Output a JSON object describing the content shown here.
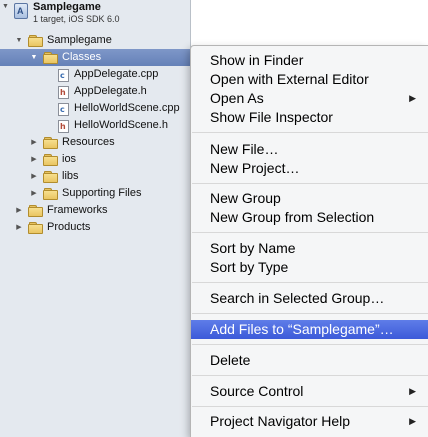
{
  "navigator": {
    "project": {
      "name": "Samplegame",
      "subtitle": "1 target, iOS SDK 6.0"
    },
    "tree": [
      {
        "label": "Samplegame",
        "kind": "folder",
        "disclosure": "expanded"
      },
      {
        "label": "Classes",
        "kind": "folder",
        "disclosure": "expanded",
        "selected": true
      },
      {
        "label": "AppDelegate.cpp",
        "kind": "file",
        "badge": "c"
      },
      {
        "label": "AppDelegate.h",
        "kind": "file",
        "badge": "h"
      },
      {
        "label": "HelloWorldScene.cpp",
        "kind": "file",
        "badge": "c"
      },
      {
        "label": "HelloWorldScene.h",
        "kind": "file",
        "badge": "h"
      },
      {
        "label": "Resources",
        "kind": "folder",
        "disclosure": "collapsed"
      },
      {
        "label": "ios",
        "kind": "folder",
        "disclosure": "collapsed"
      },
      {
        "label": "libs",
        "kind": "folder",
        "disclosure": "collapsed"
      },
      {
        "label": "Supporting Files",
        "kind": "folder",
        "disclosure": "collapsed"
      },
      {
        "label": "Frameworks",
        "kind": "folder",
        "disclosure": "collapsed"
      },
      {
        "label": "Products",
        "kind": "folder",
        "disclosure": "collapsed"
      }
    ]
  },
  "context_menu": {
    "items": [
      {
        "label": "Show in Finder"
      },
      {
        "label": "Open with External Editor"
      },
      {
        "label": "Open As",
        "submenu": true
      },
      {
        "label": "Show File Inspector"
      },
      {
        "label": "New File…"
      },
      {
        "label": "New Project…"
      },
      {
        "label": "New Group"
      },
      {
        "label": "New Group from Selection"
      },
      {
        "label": "Sort by Name"
      },
      {
        "label": "Sort by Type"
      },
      {
        "label": "Search in Selected Group…"
      },
      {
        "label": "Add Files to “Samplegame”…",
        "highlighted": true
      },
      {
        "label": "Delete"
      },
      {
        "label": "Source Control",
        "submenu": true
      },
      {
        "label": "Project Navigator Help",
        "submenu": true
      }
    ]
  },
  "icons": {
    "collapsed": "disclosure-right-icon",
    "expanded": "disclosure-down-icon",
    "submenu": "submenu-arrow-icon"
  },
  "colors": {
    "selection": "#6a86bd",
    "menu_highlight": "#4a67dd"
  }
}
